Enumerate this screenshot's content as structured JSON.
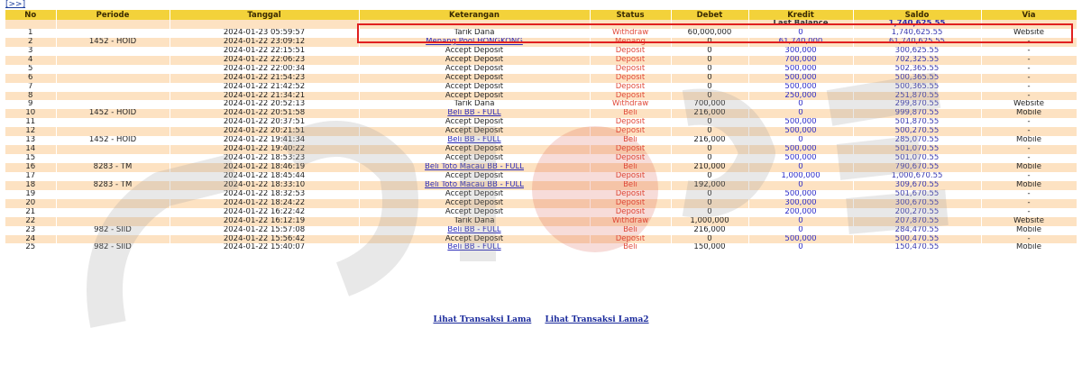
{
  "nav": {
    "top_link": "[>>]"
  },
  "table": {
    "headers": [
      "No",
      "Periode",
      "Tanggal",
      "Keterangan",
      "Status",
      "Debet",
      "Kredit",
      "Saldo",
      "Via"
    ],
    "last_balance_label": "Last Balance",
    "last_balance_value": "1,740,625.55",
    "rows": [
      [
        "1",
        "",
        "2024-01-23 05:59:57",
        "Tarik Dana",
        "Withdraw",
        "60,000,000",
        "0",
        "1,740,625.55",
        "Website"
      ],
      [
        "2",
        "1452 - HOID",
        "2024-01-22 23:09:12",
        "Menang Pool HONGKONG",
        "Menang",
        "0",
        "61,740,000",
        "61,740,625.55",
        "-"
      ],
      [
        "3",
        "",
        "2024-01-22 22:15:51",
        "Accept Deposit",
        "Deposit",
        "0",
        "300,000",
        "300,625.55",
        "-"
      ],
      [
        "4",
        "",
        "2024-01-22 22:06:23",
        "Accept Deposit",
        "Deposit",
        "0",
        "700,000",
        "702,325.55",
        "-"
      ],
      [
        "5",
        "",
        "2024-01-22 22:00:34",
        "Accept Deposit",
        "Deposit",
        "0",
        "500,000",
        "502,365.55",
        "-"
      ],
      [
        "6",
        "",
        "2024-01-22 21:54:23",
        "Accept Deposit",
        "Deposit",
        "0",
        "500,000",
        "500,365.55",
        "-"
      ],
      [
        "7",
        "",
        "2024-01-22 21:42:52",
        "Accept Deposit",
        "Deposit",
        "0",
        "500,000",
        "500,365.55",
        "-"
      ],
      [
        "8",
        "",
        "2024-01-22 21:34:21",
        "Accept Deposit",
        "Deposit",
        "0",
        "250,000",
        "251,870.55",
        "-"
      ],
      [
        "9",
        "",
        "2024-01-22 20:52:13",
        "Tarik Dana",
        "Withdraw",
        "700,000",
        "0",
        "299,870.55",
        "Website"
      ],
      [
        "10",
        "1452 - HOID",
        "2024-01-22 20:51:58",
        "Beli BB - FULL",
        "Beli",
        "216,000",
        "0",
        "999,870.55",
        "Mobile"
      ],
      [
        "11",
        "",
        "2024-01-22 20:37:51",
        "Accept Deposit",
        "Deposit",
        "0",
        "500,000",
        "501,870.55",
        "-"
      ],
      [
        "12",
        "",
        "2024-01-22 20:21:51",
        "Accept Deposit",
        "Deposit",
        "0",
        "500,000",
        "500,270.55",
        "-"
      ],
      [
        "13",
        "1452 - HOID",
        "2024-01-22 19:41:34",
        "Beli BB - FULL",
        "Beli",
        "216,000",
        "0",
        "285,070.55",
        "Mobile"
      ],
      [
        "14",
        "",
        "2024-01-22 19:40:22",
        "Accept Deposit",
        "Deposit",
        "0",
        "500,000",
        "501,070.55",
        "-"
      ],
      [
        "15",
        "",
        "2024-01-22 18:53:23",
        "Accept Deposit",
        "Deposit",
        "0",
        "500,000",
        "501,070.55",
        "-"
      ],
      [
        "16",
        "8283 - TM",
        "2024-01-22 18:46:19",
        "Beli Toto Macau BB - FULL",
        "Beli",
        "210,000",
        "0",
        "790,670.55",
        "Mobile"
      ],
      [
        "17",
        "",
        "2024-01-22 18:45:44",
        "Accept Deposit",
        "Deposit",
        "0",
        "1,000,000",
        "1,000,670.55",
        "-"
      ],
      [
        "18",
        "8283 - TM",
        "2024-01-22 18:33:10",
        "Beli Toto Macau BB - FULL",
        "Beli",
        "192,000",
        "0",
        "309,670.55",
        "Mobile"
      ],
      [
        "19",
        "",
        "2024-01-22 18:32:53",
        "Accept Deposit",
        "Deposit",
        "0",
        "500,000",
        "501,670.55",
        "-"
      ],
      [
        "20",
        "",
        "2024-01-22 18:24:22",
        "Accept Deposit",
        "Deposit",
        "0",
        "300,000",
        "300,670.55",
        "-"
      ],
      [
        "21",
        "",
        "2024-01-22 16:22:42",
        "Accept Deposit",
        "Deposit",
        "0",
        "200,000",
        "200,270.55",
        "-"
      ],
      [
        "22",
        "",
        "2024-01-22 16:12:19",
        "Tarik Dana",
        "Withdraw",
        "1,000,000",
        "0",
        "207,870.55",
        "Website"
      ],
      [
        "23",
        "982 - SIID",
        "2024-01-22 15:57:08",
        "Beli BB - FULL",
        "Beli",
        "216,000",
        "0",
        "284,470.55",
        "Mobile"
      ],
      [
        "24",
        "",
        "2024-01-22 15:56:42",
        "Accept Deposit",
        "Deposit",
        "0",
        "500,000",
        "500,470.55",
        "-"
      ],
      [
        "25",
        "982 - SIID",
        "2024-01-22 15:40:07",
        "Beli BB - FULL",
        "Beli",
        "150,000",
        "0",
        "150,470.55",
        "Mobile"
      ]
    ]
  },
  "footer": {
    "link1": "Lihat Transaksi Lama",
    "link2": "Lihat Transaksi Lama2"
  },
  "colors": {
    "header_bg": "#f3d23a",
    "row_alt_bg": "#fde2c2",
    "status_red": "#e04a3a",
    "credit_blue": "#2a2ac8",
    "highlight_border": "#e02020"
  }
}
